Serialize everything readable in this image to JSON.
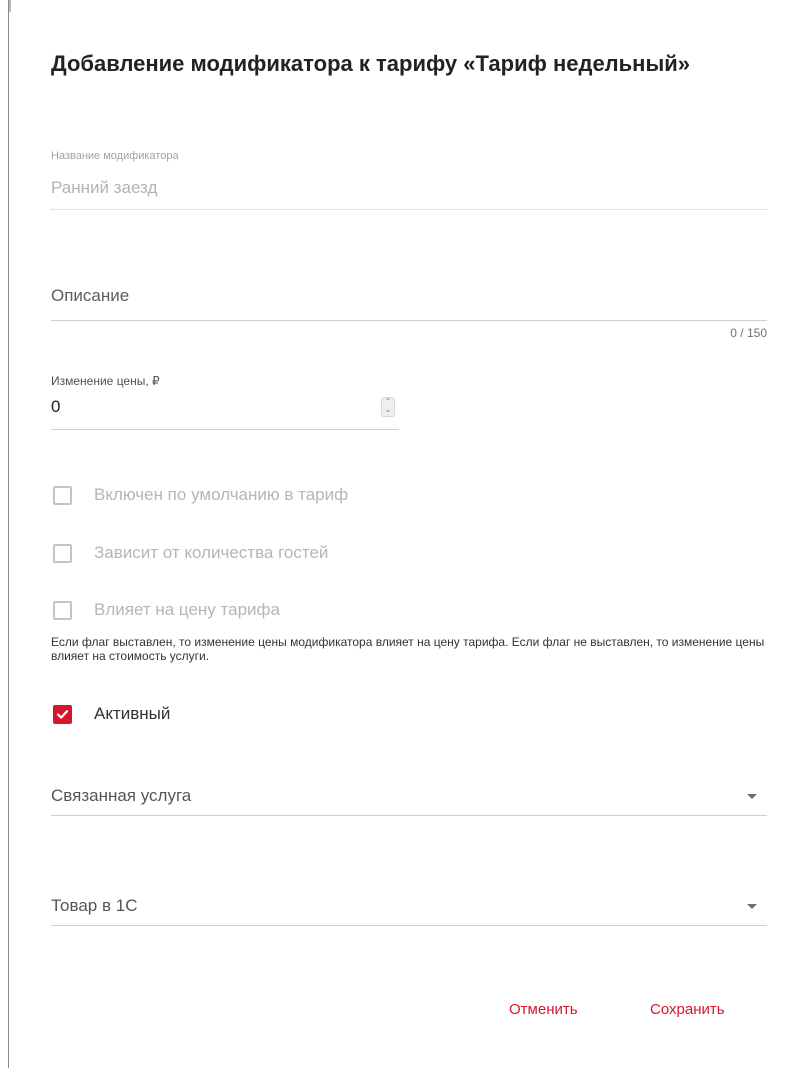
{
  "dialog": {
    "title": "Добавление модификатора к тарифу «Тариф недельный»"
  },
  "name_field": {
    "label": "Название модификатора",
    "value": "Ранний заезд"
  },
  "description_field": {
    "placeholder": "Описание",
    "counter": "0 / 150"
  },
  "price_field": {
    "label": "Изменение цены, ₽",
    "value": "0",
    "spin_up": "⌃",
    "spin_down": "⌄"
  },
  "checkboxes": [
    {
      "label": "Включен по умолчанию в тариф",
      "checked": false,
      "disabled": true
    },
    {
      "label": "Зависит от количества гостей",
      "checked": false,
      "disabled": true
    },
    {
      "label": "Влияет на цену тарифа",
      "checked": false,
      "disabled": true
    },
    {
      "label": "Активный",
      "checked": true,
      "disabled": false
    }
  ],
  "hint": "Если флаг выставлен, то изменение цены модификатора влияет на цену тарифа. Если флаг не выставлен, то изменение цены влияет на стоимость услуги.",
  "linked_service": {
    "placeholder": "Связанная услуга",
    "icon": "caret-down-icon"
  },
  "product_1c": {
    "placeholder": "Товар в 1С",
    "icon": "caret-down-icon"
  },
  "actions": {
    "cancel": "Отменить",
    "save": "Сохранить"
  },
  "colors": {
    "accent": "#d6162e",
    "text": "#222222",
    "disabled": "#b6b6b6"
  }
}
